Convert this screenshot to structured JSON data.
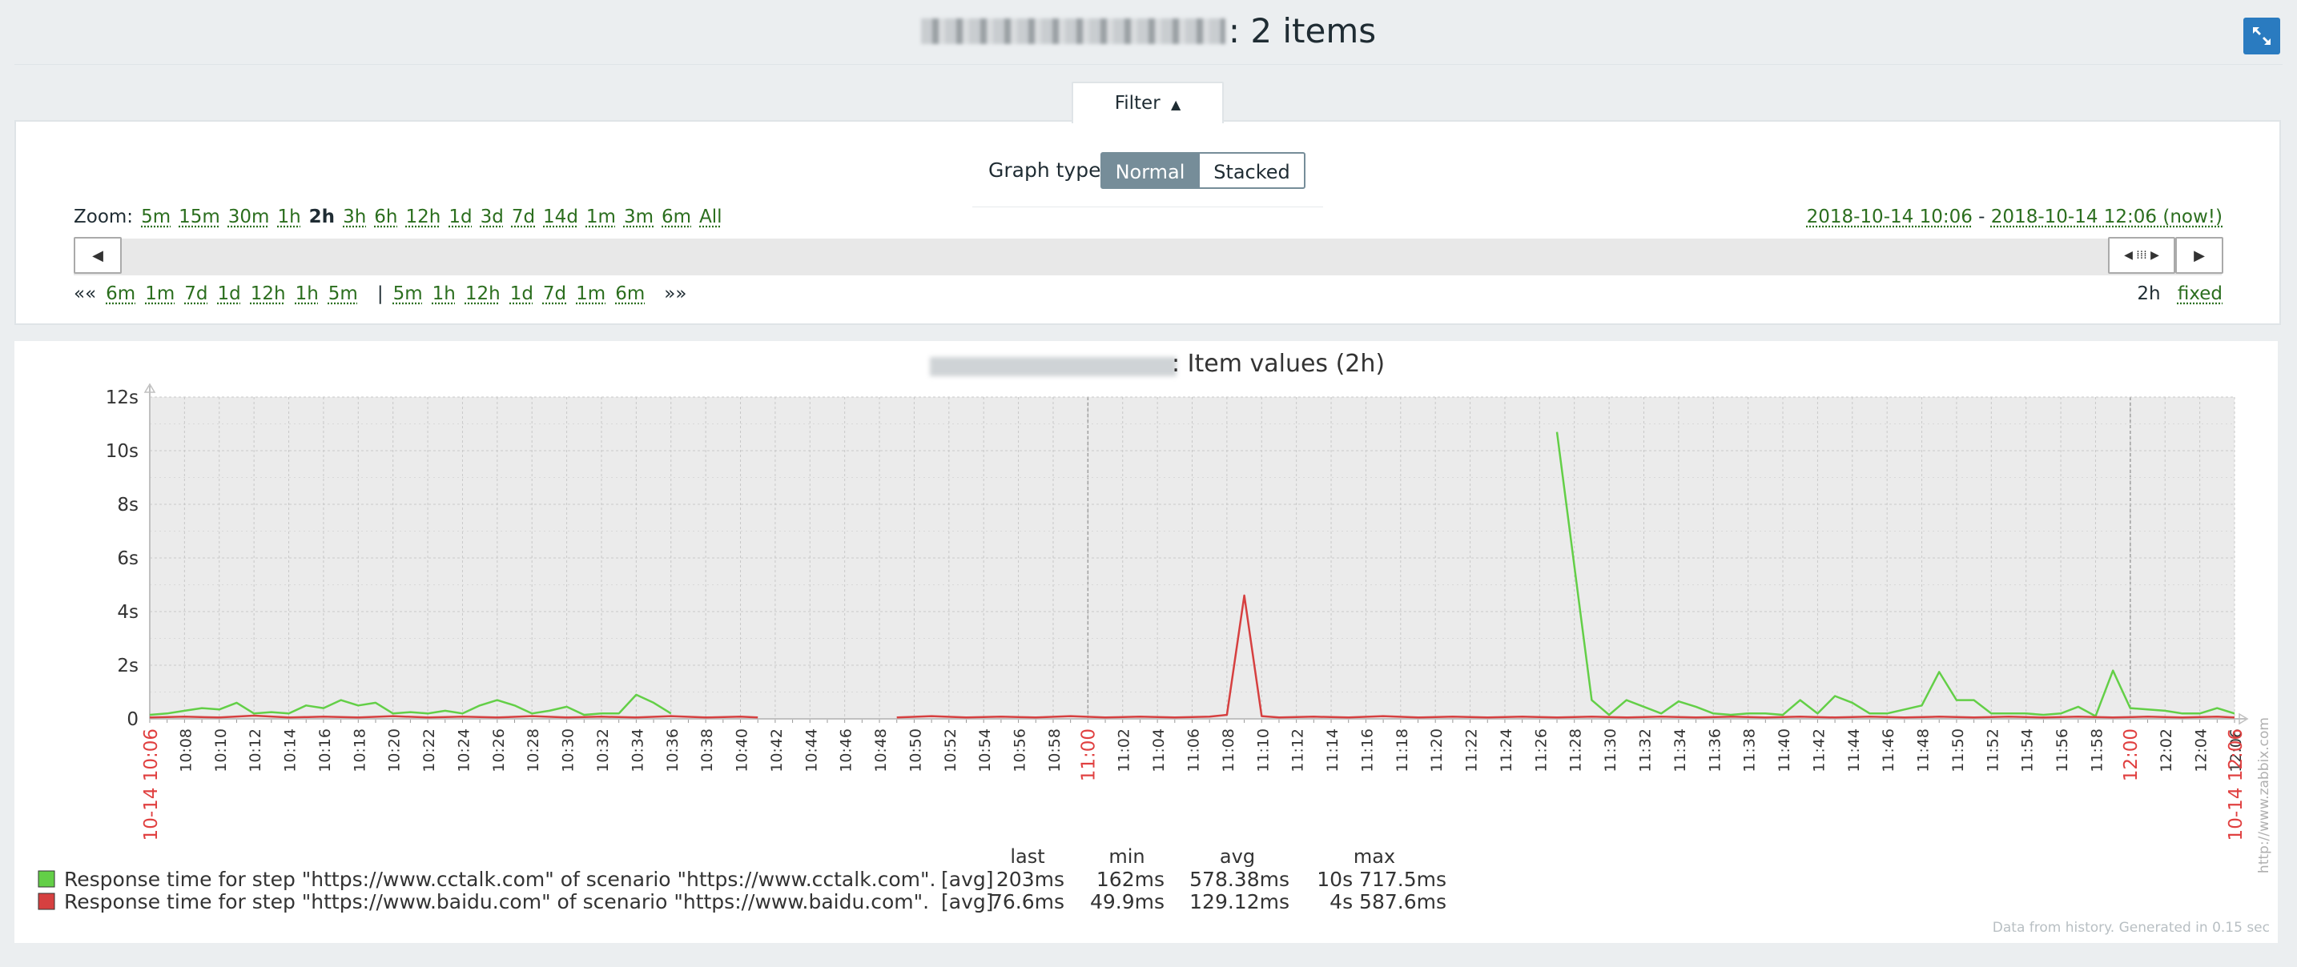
{
  "header": {
    "title_suffix": ": 2 items"
  },
  "filter": {
    "tab_label": "Filter",
    "graph_type_label": "Graph type",
    "graph_types": [
      "Normal",
      "Stacked"
    ],
    "selected_graph_type": "Normal",
    "zoom_label": "Zoom:",
    "zoom_options": [
      "5m",
      "15m",
      "30m",
      "1h",
      "2h",
      "3h",
      "6h",
      "12h",
      "1d",
      "3d",
      "7d",
      "14d",
      "1m",
      "3m",
      "6m",
      "All"
    ],
    "zoom_active": "2h",
    "from": "2018-10-14 10:06",
    "separator": "-",
    "to": "2018-10-14 12:06 (now!)",
    "nav_back_prefix": "««",
    "nav_back": [
      "6m",
      "1m",
      "7d",
      "1d",
      "12h",
      "1h",
      "5m"
    ],
    "nav_divider": "|",
    "nav_forward": [
      "5m",
      "1h",
      "12h",
      "1d",
      "7d",
      "1m",
      "6m"
    ],
    "nav_forward_suffix": "»»",
    "period": "2h",
    "fixed_label": "fixed"
  },
  "chart_data": {
    "type": "line",
    "title": ": Item values (2h)",
    "ylim": [
      0,
      12
    ],
    "y_ticks": [
      "0",
      "2s",
      "4s",
      "6s",
      "8s",
      "10s",
      "12s"
    ],
    "x_range": [
      "10:06",
      "12:06"
    ],
    "x_tick_labels": [
      "10:08",
      "10:10",
      "10:12",
      "10:14",
      "10:16",
      "10:18",
      "10:20",
      "10:22",
      "10:24",
      "10:26",
      "10:28",
      "10:30",
      "10:32",
      "10:34",
      "10:36",
      "10:38",
      "10:40",
      "10:42",
      "10:44",
      "10:46",
      "10:48",
      "10:50",
      "10:52",
      "10:54",
      "10:56",
      "10:58",
      "11:00",
      "11:02",
      "11:04",
      "11:06",
      "11:08",
      "11:10",
      "11:12",
      "11:14",
      "11:16",
      "11:18",
      "11:20",
      "11:22",
      "11:24",
      "11:26",
      "11:28",
      "11:30",
      "11:32",
      "11:34",
      "11:36",
      "11:38",
      "11:40",
      "11:42",
      "11:44",
      "11:46",
      "11:48",
      "11:50",
      "11:52",
      "11:54",
      "11:56",
      "11:58",
      "12:00",
      "12:02",
      "12:04",
      "12:06"
    ],
    "highlight_ticks": [
      "11:00",
      "12:00"
    ],
    "x_edge_labels": [
      "10-14 10:06",
      "10-14 12:06"
    ],
    "watermark": "http://www.zabbix.com",
    "series": [
      {
        "name": "Response time for step \"https://www.cctalk.com\" of scenario \"https://www.cctalk.com\".",
        "color": "#63cf47",
        "func": "[avg]",
        "last": "203ms",
        "min": "162ms",
        "avg": "578.38ms",
        "max": "10s 717.5ms",
        "points": [
          [
            "10:06",
            0.15
          ],
          [
            "10:07",
            0.2
          ],
          [
            "10:08",
            0.3
          ],
          [
            "10:09",
            0.4
          ],
          [
            "10:10",
            0.35
          ],
          [
            "10:11",
            0.6
          ],
          [
            "10:12",
            0.2
          ],
          [
            "10:13",
            0.25
          ],
          [
            "10:14",
            0.2
          ],
          [
            "10:15",
            0.5
          ],
          [
            "10:16",
            0.4
          ],
          [
            "10:17",
            0.7
          ],
          [
            "10:18",
            0.5
          ],
          [
            "10:19",
            0.6
          ],
          [
            "10:20",
            0.2
          ],
          [
            "10:21",
            0.25
          ],
          [
            "10:22",
            0.2
          ],
          [
            "10:23",
            0.3
          ],
          [
            "10:24",
            0.2
          ],
          [
            "10:25",
            0.5
          ],
          [
            "10:26",
            0.7
          ],
          [
            "10:27",
            0.5
          ],
          [
            "10:28",
            0.2
          ],
          [
            "10:29",
            0.3
          ],
          [
            "10:30",
            0.45
          ],
          [
            "10:31",
            0.15
          ],
          [
            "10:32",
            0.2
          ],
          [
            "10:33",
            0.2
          ],
          [
            "10:34",
            0.9
          ],
          [
            "10:35",
            0.6
          ],
          [
            "10:36",
            0.2
          ],
          null,
          [
            "11:27",
            10.7
          ],
          [
            "11:29",
            0.7
          ],
          [
            "11:30",
            0.15
          ],
          [
            "11:31",
            0.7
          ],
          [
            "11:32",
            0.45
          ],
          [
            "11:33",
            0.2
          ],
          [
            "11:34",
            0.65
          ],
          [
            "11:35",
            0.45
          ],
          [
            "11:36",
            0.2
          ],
          [
            "11:37",
            0.15
          ],
          [
            "11:38",
            0.2
          ],
          [
            "11:39",
            0.2
          ],
          [
            "11:40",
            0.15
          ],
          [
            "11:41",
            0.7
          ],
          [
            "11:42",
            0.2
          ],
          [
            "11:43",
            0.85
          ],
          [
            "11:44",
            0.6
          ],
          [
            "11:45",
            0.2
          ],
          [
            "11:46",
            0.2
          ],
          [
            "11:47",
            0.35
          ],
          [
            "11:48",
            0.5
          ],
          [
            "11:49",
            1.75
          ],
          [
            "11:50",
            0.7
          ],
          [
            "11:51",
            0.7
          ],
          [
            "11:52",
            0.2
          ],
          [
            "11:53",
            0.2
          ],
          [
            "11:54",
            0.2
          ],
          [
            "11:55",
            0.15
          ],
          [
            "11:56",
            0.2
          ],
          [
            "11:57",
            0.45
          ],
          [
            "11:58",
            0.1
          ],
          [
            "11:59",
            1.8
          ],
          [
            "12:00",
            0.4
          ],
          [
            "12:01",
            0.35
          ],
          [
            "12:02",
            0.3
          ],
          [
            "12:03",
            0.2
          ],
          [
            "12:04",
            0.2
          ],
          [
            "12:05",
            0.4
          ],
          [
            "12:06",
            0.2
          ]
        ]
      },
      {
        "name": "Response time for step \"https://www.baidu.com\" of scenario \"https://www.baidu.com\".",
        "color": "#d64040",
        "func": "[avg]",
        "last": "76.6ms",
        "min": "49.9ms",
        "avg": "129.12ms",
        "max": "4s 587.6ms",
        "points": [
          [
            "10:06",
            0.05
          ],
          [
            "10:08",
            0.08
          ],
          [
            "10:10",
            0.05
          ],
          [
            "10:12",
            0.12
          ],
          [
            "10:14",
            0.05
          ],
          [
            "10:16",
            0.08
          ],
          [
            "10:18",
            0.05
          ],
          [
            "10:20",
            0.1
          ],
          [
            "10:22",
            0.05
          ],
          [
            "10:24",
            0.08
          ],
          [
            "10:26",
            0.05
          ],
          [
            "10:28",
            0.1
          ],
          [
            "10:30",
            0.05
          ],
          [
            "10:32",
            0.08
          ],
          [
            "10:34",
            0.05
          ],
          [
            "10:36",
            0.1
          ],
          [
            "10:38",
            0.05
          ],
          [
            "10:40",
            0.08
          ],
          [
            "10:41",
            0.05
          ],
          null,
          [
            "10:49",
            0.05
          ],
          [
            "10:51",
            0.1
          ],
          [
            "10:53",
            0.05
          ],
          [
            "10:55",
            0.08
          ],
          [
            "10:57",
            0.05
          ],
          [
            "10:59",
            0.1
          ],
          [
            "11:01",
            0.05
          ],
          [
            "11:03",
            0.08
          ],
          [
            "11:05",
            0.05
          ],
          [
            "11:07",
            0.08
          ],
          [
            "11:08",
            0.15
          ],
          [
            "11:09",
            4.6
          ],
          [
            "11:10",
            0.1
          ],
          [
            "11:11",
            0.05
          ],
          [
            "11:13",
            0.08
          ],
          [
            "11:15",
            0.05
          ],
          [
            "11:17",
            0.1
          ],
          [
            "11:19",
            0.05
          ],
          [
            "11:21",
            0.08
          ],
          [
            "11:23",
            0.05
          ],
          [
            "11:25",
            0.08
          ],
          [
            "11:27",
            0.05
          ],
          [
            "11:29",
            0.08
          ],
          [
            "11:31",
            0.05
          ],
          [
            "11:33",
            0.08
          ],
          [
            "11:35",
            0.05
          ],
          [
            "11:37",
            0.08
          ],
          [
            "11:39",
            0.05
          ],
          [
            "11:41",
            0.08
          ],
          [
            "11:43",
            0.05
          ],
          [
            "11:45",
            0.08
          ],
          [
            "11:47",
            0.05
          ],
          [
            "11:49",
            0.08
          ],
          [
            "11:51",
            0.05
          ],
          [
            "11:53",
            0.08
          ],
          [
            "11:55",
            0.05
          ],
          [
            "11:57",
            0.08
          ],
          [
            "11:59",
            0.05
          ],
          [
            "12:01",
            0.08
          ],
          [
            "12:03",
            0.05
          ],
          [
            "12:05",
            0.08
          ],
          [
            "12:06",
            0.05
          ]
        ]
      }
    ],
    "legend_headers": [
      "last",
      "min",
      "avg",
      "max"
    ],
    "footer": "Data from history. Generated in 0.15 sec"
  },
  "colors": {
    "accent": "#2a7bc0",
    "link": "#2b6e1e",
    "selected_button": "#768d99",
    "highlight": "#e04040",
    "plot_bg": "#ebebeb"
  },
  "icons": {
    "fullscreen": "fullscreen-icon",
    "filter_toggle": "triangle-up-icon",
    "scroll_left": "triangle-left-icon",
    "scroll_right": "triangle-right-icon",
    "handle": "drag-handle-icon"
  }
}
